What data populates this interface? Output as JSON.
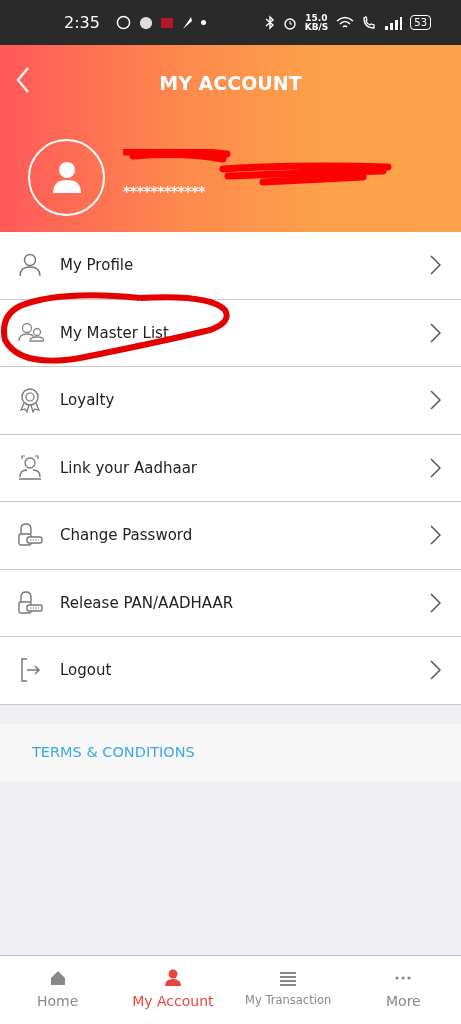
{
  "status_bar": {
    "time": "2:35",
    "speed": "15.0",
    "speed_unit": "KB/S",
    "battery": "53"
  },
  "header": {
    "title": "MY ACCOUNT"
  },
  "profile": {
    "masked_id": "************",
    "redacted": true
  },
  "menu": [
    {
      "kind": "person",
      "label": "My Profile",
      "circled": false
    },
    {
      "kind": "group",
      "label": "My Master List",
      "circled": true
    },
    {
      "kind": "badge",
      "label": "Loyalty",
      "circled": false
    },
    {
      "kind": "face",
      "label": "Link your Aadhaar",
      "circled": false
    },
    {
      "kind": "lock",
      "label": "Change Password",
      "circled": false
    },
    {
      "kind": "lock",
      "label": "Release PAN/AADHAAR",
      "circled": false
    },
    {
      "kind": "logout",
      "label": "Logout",
      "circled": false
    }
  ],
  "terms_link": "TERMS & CONDITIONS",
  "bottom_nav": [
    {
      "kind": "home",
      "label": "Home",
      "selected": false
    },
    {
      "kind": "person",
      "label": "My Account",
      "selected": true
    },
    {
      "kind": "list",
      "label": "My Transaction",
      "selected": false
    },
    {
      "kind": "more",
      "label": "More",
      "selected": false
    }
  ]
}
